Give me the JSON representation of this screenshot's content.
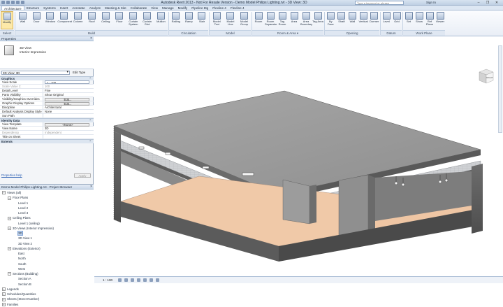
{
  "window": {
    "title": "Autodesk Revit 2013 - Not For Resale Version - Demo Model Philips Lighting.rvt - 3D View: 3D",
    "search_placeholder": "Type a keyword or phrase",
    "sign_in": "Sign In",
    "controls": [
      "–",
      "❐",
      "✕"
    ]
  },
  "tabs": [
    "Architecture",
    "Structure",
    "Systems",
    "Insert",
    "Annotate",
    "Analyze",
    "Massing & Site",
    "Collaborate",
    "View",
    "Manage",
    "Modify",
    "Pipeline 8tg",
    "Flexline 4",
    "Flexline 4"
  ],
  "ribbon": {
    "modify": "Modify",
    "build": [
      "Wall",
      "Door",
      "Window",
      "Component",
      "Column",
      "Roof",
      "Ceiling",
      "Floor",
      "Curtain System",
      "Curtain Grid",
      "Mullion"
    ],
    "circulation": [
      "Railing",
      "Ramp",
      "Stair"
    ],
    "model": [
      "Model Text",
      "Model Line",
      "Model Group"
    ],
    "room_area": [
      "Room",
      "Room Separator",
      "Tag Room",
      "Area",
      "Area Boundary",
      "Tag Area"
    ],
    "opening": [
      "By Face",
      "Shaft",
      "Wall",
      "Vertical",
      "Dormer"
    ],
    "datum": [
      "Level",
      "Grid"
    ],
    "workplane": [
      "Set",
      "Show",
      "Ref Plane",
      "Viewer"
    ],
    "panels": {
      "select": "Select",
      "build": "Build",
      "circulation": "Circulation",
      "model": "Model",
      "room_area": "Room & Area ▾",
      "opening": "Opening",
      "datum": "Datum",
      "workplane": "Work Plane"
    }
  },
  "properties": {
    "header": "Properties",
    "type_name": "3D View",
    "type_sub": "Interior Impression",
    "instance": "3D View: 3D",
    "edit_type": "Edit Type",
    "groups": [
      {
        "name": "Graphics",
        "rows": [
          {
            "k": "View Scale",
            "v": "1 : 100",
            "style": "input"
          },
          {
            "k": "Scale Value    1:",
            "v": "100",
            "style": "dim"
          },
          {
            "k": "Detail Level",
            "v": "Fine"
          },
          {
            "k": "Parts Visibility",
            "v": "Show Original"
          },
          {
            "k": "Visibility/Graphics Overrides",
            "v": "Edit...",
            "style": "btn"
          },
          {
            "k": "Graphic Display Options",
            "v": "Edit...",
            "style": "btn"
          },
          {
            "k": "Discipline",
            "v": "Architectural"
          },
          {
            "k": "Default Analysis Display Style",
            "v": "None"
          },
          {
            "k": "Sun Path",
            "v": ""
          }
        ]
      },
      {
        "name": "Identity Data",
        "rows": [
          {
            "k": "View Template",
            "v": "<None>",
            "style": "btn"
          },
          {
            "k": "View Name",
            "v": "3D"
          },
          {
            "k": "Dependency",
            "v": "Independent",
            "style": "dim"
          },
          {
            "k": "Title on Sheet",
            "v": ""
          }
        ]
      },
      {
        "name": "Extents",
        "rows": []
      }
    ],
    "help": "Properties help",
    "apply": "Apply"
  },
  "browser": {
    "header": "Demo Model Philips Lighting.rvt - Project Browser",
    "nodes": [
      {
        "d": 0,
        "t": "−",
        "label": "Views (all)"
      },
      {
        "d": 1,
        "t": "−",
        "label": "Floor Plans"
      },
      {
        "d": 2,
        "t": "",
        "label": "Level 1"
      },
      {
        "d": 2,
        "t": "",
        "label": "Level 2"
      },
      {
        "d": 2,
        "t": "",
        "label": "Level 3"
      },
      {
        "d": 1,
        "t": "−",
        "label": "Ceiling Plans"
      },
      {
        "d": 2,
        "t": "",
        "label": "Level 1 (ceiling)"
      },
      {
        "d": 1,
        "t": "−",
        "label": "3D Views (Interior Impression)"
      },
      {
        "d": 2,
        "t": "",
        "label": "3D",
        "sel": true
      },
      {
        "d": 2,
        "t": "",
        "label": "3D View 1"
      },
      {
        "d": 2,
        "t": "",
        "label": "3D View 2"
      },
      {
        "d": 1,
        "t": "−",
        "label": "Elevations (Exterior)"
      },
      {
        "d": 2,
        "t": "",
        "label": "East"
      },
      {
        "d": 2,
        "t": "",
        "label": "North"
      },
      {
        "d": 2,
        "t": "",
        "label": "South"
      },
      {
        "d": 2,
        "t": "",
        "label": "West"
      },
      {
        "d": 1,
        "t": "−",
        "label": "Sections (Building)"
      },
      {
        "d": 2,
        "t": "",
        "label": "Section A"
      },
      {
        "d": 2,
        "t": "",
        "label": "Section B"
      },
      {
        "d": 0,
        "t": "+",
        "label": "Legends"
      },
      {
        "d": 0,
        "t": "+",
        "label": "Schedules/Quantities"
      },
      {
        "d": 0,
        "t": "+",
        "label": "Sheets (Street Number)"
      },
      {
        "d": 0,
        "t": "+",
        "label": "Families"
      }
    ]
  },
  "viewcube": {
    "face": "RIGHT"
  },
  "view_control": {
    "scale": "1 : 100"
  }
}
